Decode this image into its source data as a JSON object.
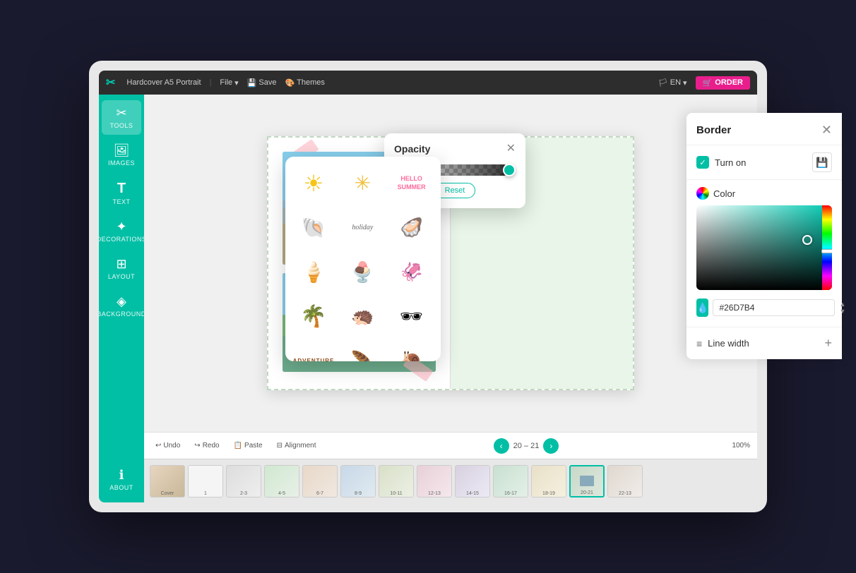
{
  "topbar": {
    "logo": "✂",
    "title": "Hardcover A5 Portrait",
    "file_label": "File",
    "save_label": "Save",
    "themes_label": "Themes",
    "lang": "EN",
    "order_label": "ORDER"
  },
  "sidebar": {
    "items": [
      {
        "id": "tools",
        "icon": "✂",
        "label": "TOOLS"
      },
      {
        "id": "images",
        "icon": "🖼",
        "label": "IMAGES"
      },
      {
        "id": "text",
        "icon": "T",
        "label": "TEXT"
      },
      {
        "id": "decorations",
        "icon": "✦",
        "label": "DECORATIONS"
      },
      {
        "id": "layout",
        "icon": "⊞",
        "label": "LAYOUT"
      },
      {
        "id": "background",
        "icon": "◈",
        "label": "BACKGROUND"
      },
      {
        "id": "about",
        "icon": "ℹ",
        "label": "ABOUT"
      }
    ]
  },
  "bottombar": {
    "undo_label": "Undo",
    "redo_label": "Redo",
    "paste_label": "Paste",
    "alignment_label": "Alignment",
    "page_current": "20 – 21",
    "zoom_label": "100%"
  },
  "opacity_popup": {
    "title": "Opacity",
    "reset_label": "Reset"
  },
  "border_panel": {
    "title": "Border",
    "turn_on_label": "Turn on",
    "color_label": "Color",
    "hex_value": "#26D7B4",
    "line_width_label": "Line width"
  },
  "stickers": [
    {
      "type": "sun_solid",
      "emoji": "☀"
    },
    {
      "type": "sun_outline",
      "emoji": "✳"
    },
    {
      "type": "hello_summer",
      "text": "HELLO SUMMER"
    },
    {
      "type": "shell1",
      "emoji": "🐚"
    },
    {
      "type": "holiday_text",
      "text": "holiday"
    },
    {
      "type": "shell2",
      "emoji": "🦪"
    },
    {
      "type": "icecream1",
      "emoji": "🍦"
    },
    {
      "type": "icecream2",
      "emoji": "🍨"
    },
    {
      "type": "shell3",
      "emoji": "🦑"
    },
    {
      "type": "palmtree",
      "emoji": "🌴"
    },
    {
      "type": "hedgehog",
      "emoji": "🦔"
    },
    {
      "type": "sunglasses",
      "emoji": "🕶"
    },
    {
      "type": "adventure",
      "text": "ADVENTURE"
    },
    {
      "type": "feather",
      "emoji": "🪶"
    },
    {
      "type": "snail",
      "emoji": "🐌"
    }
  ],
  "thumbnails": [
    {
      "label": "Cover",
      "active": false
    },
    {
      "label": "1",
      "active": false
    },
    {
      "label": "2-3",
      "active": false
    },
    {
      "label": "4-5",
      "active": false
    },
    {
      "label": "6-7",
      "active": false
    },
    {
      "label": "8-9",
      "active": false
    },
    {
      "label": "10-11",
      "active": false
    },
    {
      "label": "12-13",
      "active": false
    },
    {
      "label": "14-15",
      "active": false
    },
    {
      "label": "16-17",
      "active": false
    },
    {
      "label": "18-19",
      "active": false
    },
    {
      "label": "20-21",
      "active": true
    },
    {
      "label": "22-13",
      "active": false
    }
  ]
}
